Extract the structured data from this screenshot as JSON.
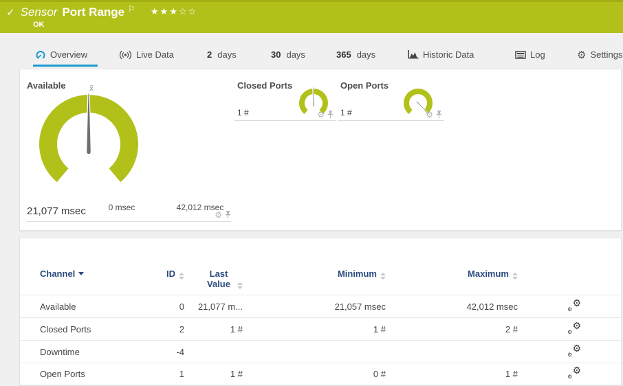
{
  "header": {
    "check_icon": "✓",
    "kind": "Sensor",
    "title": "Port Range",
    "flag_icon": "⚐",
    "stars_filled": "★★★",
    "stars_empty": "☆☆",
    "status": "OK"
  },
  "tabs": [
    {
      "label": "Overview",
      "icon": "gauge-icon",
      "active": true
    },
    {
      "label": "Live Data",
      "icon": "live-broadcast-icon",
      "active": false
    },
    {
      "prefix": "2",
      "label": "days",
      "active": false
    },
    {
      "prefix": "30",
      "label": "days",
      "active": false
    },
    {
      "prefix": "365",
      "label": "days",
      "active": false
    },
    {
      "label": "Historic Data",
      "icon": "historic-chart-icon",
      "active": false
    },
    {
      "label": "Log",
      "icon": "log-icon",
      "active": false
    },
    {
      "label": "Settings",
      "icon": "gear-icon",
      "active": false
    }
  ],
  "gauges": {
    "available": {
      "title": "Available",
      "value": "21,077 msec",
      "scale_min": "0 msec",
      "scale_max": "42,012 msec",
      "avg_marker": "x̄"
    },
    "closed_ports": {
      "title": "Closed Ports",
      "value": "1 #"
    },
    "open_ports": {
      "title": "Open Ports",
      "value": "1 #"
    }
  },
  "table": {
    "headers": {
      "channel": "Channel",
      "id": "ID",
      "last_value": "Last Value",
      "minimum": "Minimum",
      "maximum": "Maximum"
    },
    "rows": [
      {
        "channel": "Available",
        "id": "0",
        "last_value": "21,077 m...",
        "minimum": "21,057 msec",
        "maximum": "42,012 msec"
      },
      {
        "channel": "Closed Ports",
        "id": "2",
        "last_value": "1 #",
        "minimum": "1 #",
        "maximum": "2 #"
      },
      {
        "channel": "Downtime",
        "id": "-4",
        "last_value": "",
        "minimum": "",
        "maximum": ""
      },
      {
        "channel": "Open Ports",
        "id": "1",
        "last_value": "1 #",
        "minimum": "0 #",
        "maximum": "1 #"
      }
    ]
  },
  "icons": {
    "gear_glyph": "⚙",
    "pin": "pushpin-icon",
    "row_settings": "channel-settings-gears-icon"
  },
  "colors": {
    "brand_green": "#b2c119",
    "accent_blue": "#1d9bd1",
    "table_header_blue": "#2b4a7d",
    "needle_gray": "#6f6f6f"
  }
}
